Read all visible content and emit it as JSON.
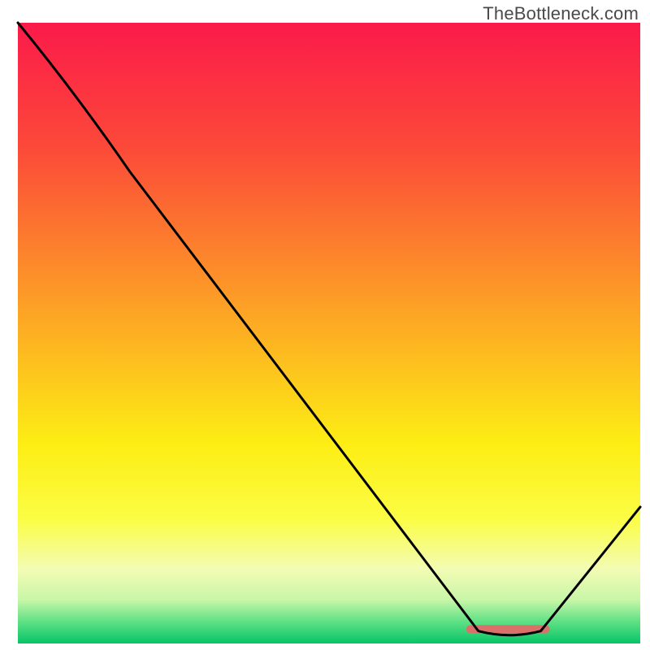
{
  "watermark": "TheBottleneck.com",
  "chart_data": {
    "type": "line",
    "title": "",
    "xlabel": "",
    "ylabel": "",
    "xlim": [
      0,
      100
    ],
    "ylim": [
      0,
      100
    ],
    "x": [
      0,
      18,
      74,
      84,
      100
    ],
    "values": [
      100,
      76,
      2,
      2,
      22
    ],
    "gradient_stops": [
      {
        "offset": 0.0,
        "color": "#fb1a4a"
      },
      {
        "offset": 0.2,
        "color": "#fc4939"
      },
      {
        "offset": 0.45,
        "color": "#fd9e26"
      },
      {
        "offset": 0.68,
        "color": "#fdee14"
      },
      {
        "offset": 0.8,
        "color": "#fbfd45"
      },
      {
        "offset": 0.88,
        "color": "#f3fcb4"
      },
      {
        "offset": 0.93,
        "color": "#c8f6a8"
      },
      {
        "offset": 0.965,
        "color": "#5ee085"
      },
      {
        "offset": 1.0,
        "color": "#06c567"
      }
    ],
    "marker": {
      "x_frac_start": 0.727,
      "x_frac_end": 0.848,
      "y_frac": 0.977,
      "color": "#d9706a"
    }
  }
}
